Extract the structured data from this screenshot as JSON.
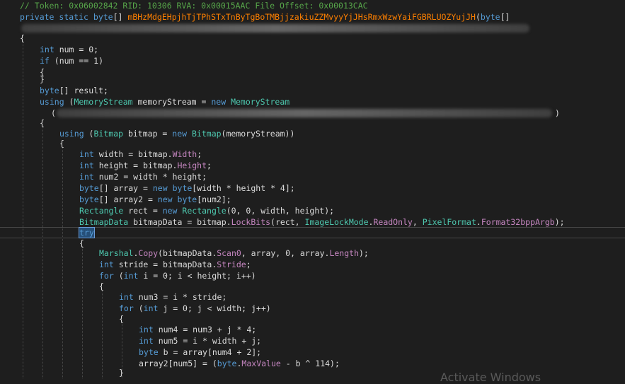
{
  "header": {
    "comment": "// Token: 0x06002842 RID: 10306 RVA: 0x00015AAC File Offset: 0x00013CAC",
    "kw_private": "private",
    "kw_static": "static",
    "kw_byte": "byte",
    "brackets": "[]",
    "method_name": "mBHzMdgEHpjhTjTPhSTxTnByTgBoTMBjjzakiuZZMvyyYjJHsRmxWzwYaiFGBRLUOZYujJH",
    "paren_open": "(",
    "param_type": "byte",
    "param_brackets": "[]"
  },
  "code": {
    "l3": "{",
    "l4_kw": "int",
    "l4_rest": " num = 0;",
    "l5_kw": "if",
    "l5_rest": " (num == 1)",
    "l6": "{",
    "l7": "}",
    "l8_kw": "byte",
    "l8_rest": "[] result;",
    "l9_kw": "using",
    "l9_a": " (",
    "l9_type": "MemoryStream",
    "l9_b": " memoryStream = ",
    "l9_new": "new",
    "l9_sp": " ",
    "l9_type2": "MemoryStream",
    "l10_open": "(",
    "l10_close": ")",
    "l11": "{",
    "l12_kw": "using",
    "l12_a": " (",
    "l12_type": "Bitmap",
    "l12_b": " bitmap = ",
    "l12_new": "new",
    "l12_sp": " ",
    "l12_type2": "Bitmap",
    "l12_c": "(memoryStream))",
    "l13": "{",
    "l14_kw": "int",
    "l14_a": " width = bitmap.",
    "l14_prop": "Width",
    "l14_b": ";",
    "l15_kw": "int",
    "l15_a": " height = bitmap.",
    "l15_prop": "Height",
    "l15_b": ";",
    "l16_kw": "int",
    "l16_a": " num2 = width * height;",
    "l17_kw": "byte",
    "l17_a": "[] array = ",
    "l17_new": "new",
    "l17_sp": " ",
    "l17_kw2": "byte",
    "l17_b": "[width * height * 4];",
    "l18_kw": "byte",
    "l18_a": "[] array2 = ",
    "l18_new": "new",
    "l18_sp": " ",
    "l18_kw2": "byte",
    "l18_b": "[num2];",
    "l19_type": "Rectangle",
    "l19_a": " rect = ",
    "l19_new": "new",
    "l19_sp": " ",
    "l19_type2": "Rectangle",
    "l19_b": "(0, 0, width, height);",
    "l20_type": "BitmapData",
    "l20_a": " bitmapData = bitmap.",
    "l20_m": "LockBits",
    "l20_b": "(rect, ",
    "l20_t2": "ImageLockMode",
    "l20_dot": ".",
    "l20_p": "ReadOnly",
    "l20_c": ", ",
    "l20_t3": "PixelFormat",
    "l20_dot2": ".",
    "l20_p2": "Format32bppArgb",
    "l20_d": ");",
    "l21_kw": "try",
    "l22": "{",
    "l23_type": "Marshal",
    "l23_dot": ".",
    "l23_m": "Copy",
    "l23_a": "(bitmapData.",
    "l23_p": "Scan0",
    "l23_b": ", array, 0, array.",
    "l23_p2": "Length",
    "l23_c": ");",
    "l24_kw": "int",
    "l24_a": " stride = bitmapData.",
    "l24_p": "Stride",
    "l24_b": ";",
    "l25_kw": "for",
    "l25_a": " (",
    "l25_kw2": "int",
    "l25_b": " i = 0; i < height; i++)",
    "l26": "{",
    "l27_kw": "int",
    "l27_a": " num3 = i * stride;",
    "l28_kw": "for",
    "l28_a": " (",
    "l28_kw2": "int",
    "l28_b": " j = 0; j < width; j++)",
    "l29": "{",
    "l30_kw": "int",
    "l30_a": " num4 = num3 + j * 4;",
    "l31_kw": "int",
    "l31_a": " num5 = i * width + j;",
    "l32_kw": "byte",
    "l32_a": " b = array[num4 + 2];",
    "l33_a": "array2[num5] = (",
    "l33_kw": "byte",
    "l33_dot": ".",
    "l33_p": "MaxValue",
    "l33_b": " - b ^ 114);",
    "l34": "}"
  },
  "watermark": "Activate Windows",
  "colors": {
    "background": "#1e1e1e",
    "keyword": "#569cd6",
    "type": "#4ec9b0",
    "property": "#c586c0",
    "comment": "#57a64a",
    "method_name": "#ff8000",
    "text": "#dcdcdc"
  }
}
